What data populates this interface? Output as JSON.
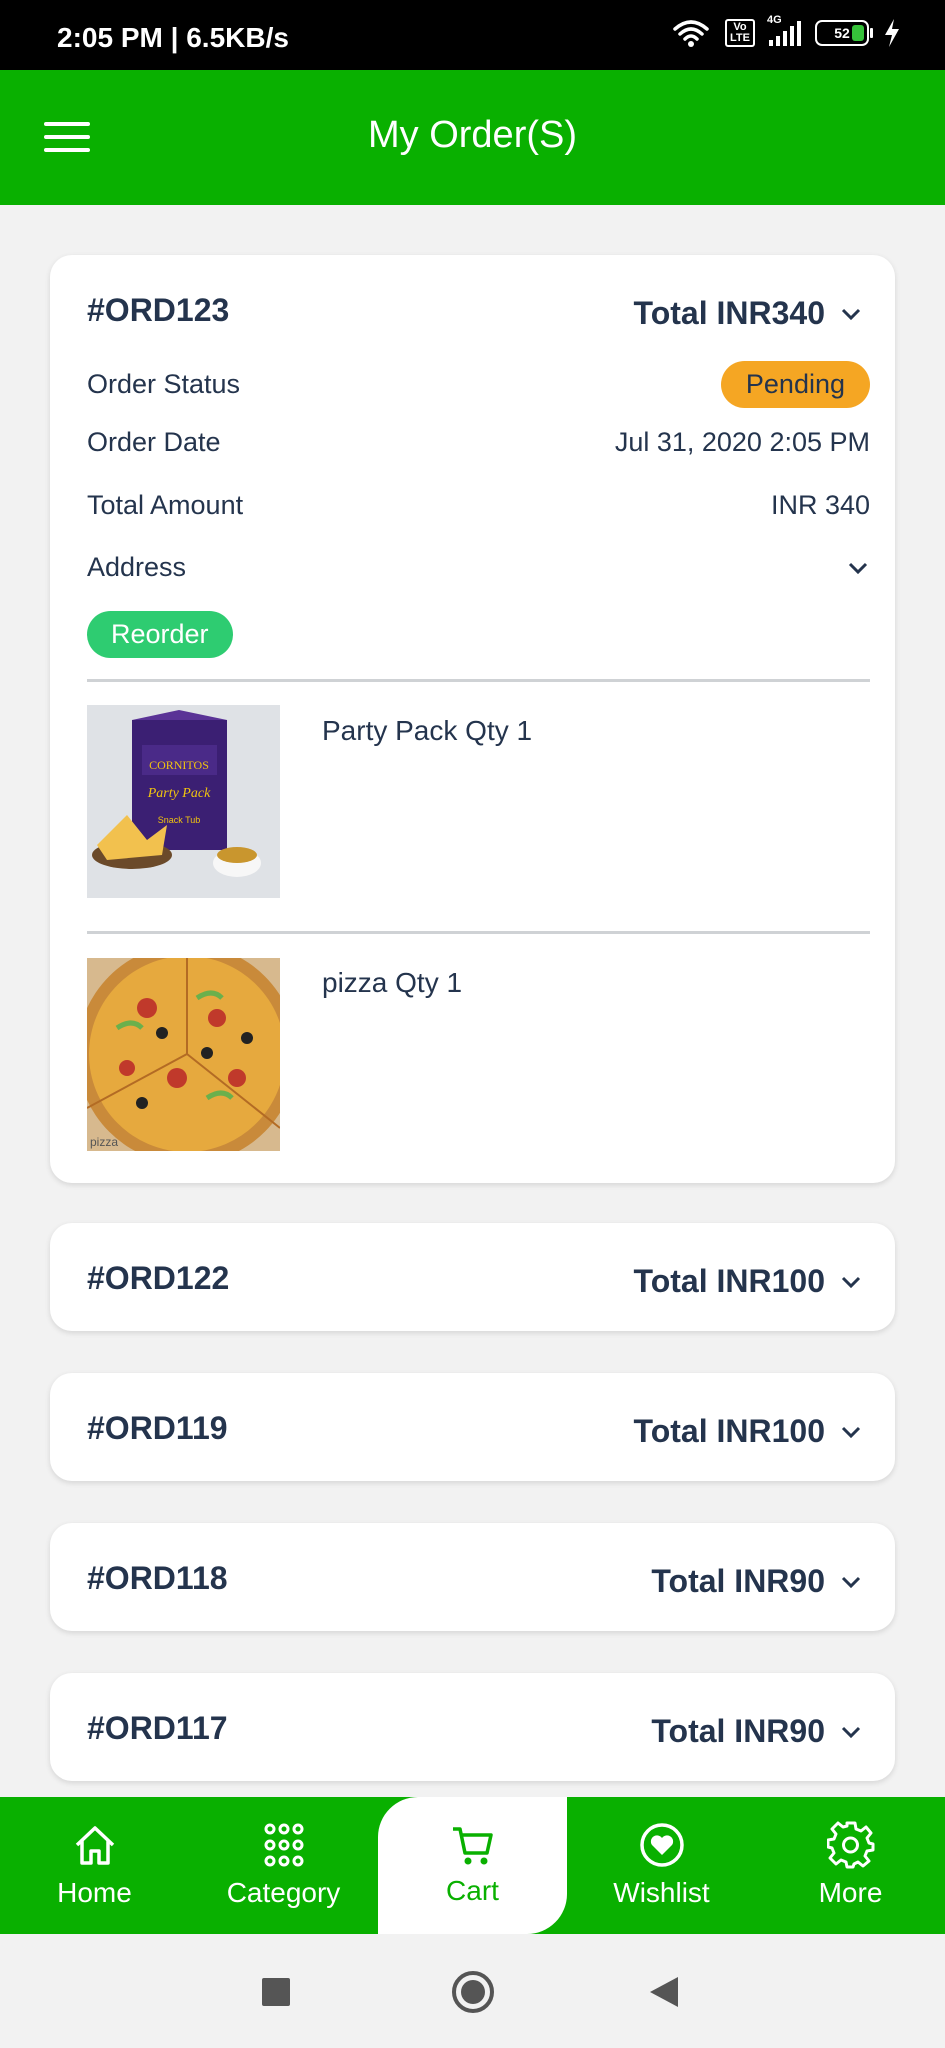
{
  "status_bar": {
    "time": "2:05 PM | 6.5KB/s",
    "network_label": "4G",
    "volte_label": "Vo LTE",
    "battery": "52"
  },
  "app_bar": {
    "title": "My Order(S)"
  },
  "orders": [
    {
      "id": "#ORD123",
      "total": "Total INR340",
      "status_label": "Order Status",
      "status": "Pending",
      "date_label": "Order Date",
      "date": "Jul 31, 2020 2:05 PM",
      "amount_label": "Total Amount",
      "amount": "INR 340",
      "address_label": "Address",
      "reorder": "Reorder",
      "items": [
        {
          "name": "Party Pack Qty 1",
          "image_brand": "CORNITOS",
          "image_text": "Party Pack",
          "image_sub": "Snack Tub"
        },
        {
          "name": "pizza Qty 1",
          "image_caption": "pizza"
        }
      ]
    },
    {
      "id": "#ORD122",
      "total": "Total INR100"
    },
    {
      "id": "#ORD119",
      "total": "Total INR100"
    },
    {
      "id": "#ORD118",
      "total": "Total INR90"
    },
    {
      "id": "#ORD117",
      "total": "Total INR90"
    }
  ],
  "bottom_nav": [
    {
      "label": "Home",
      "icon": "home-icon"
    },
    {
      "label": "Category",
      "icon": "grid-icon"
    },
    {
      "label": "Cart",
      "icon": "cart-icon",
      "active": true
    },
    {
      "label": "Wishlist",
      "icon": "heart-icon"
    },
    {
      "label": "More",
      "icon": "gear-icon"
    }
  ],
  "colors": {
    "brand_green": "#09b000",
    "pending": "#f5a623",
    "reorder": "#2ecc71",
    "text": "#24344d"
  }
}
